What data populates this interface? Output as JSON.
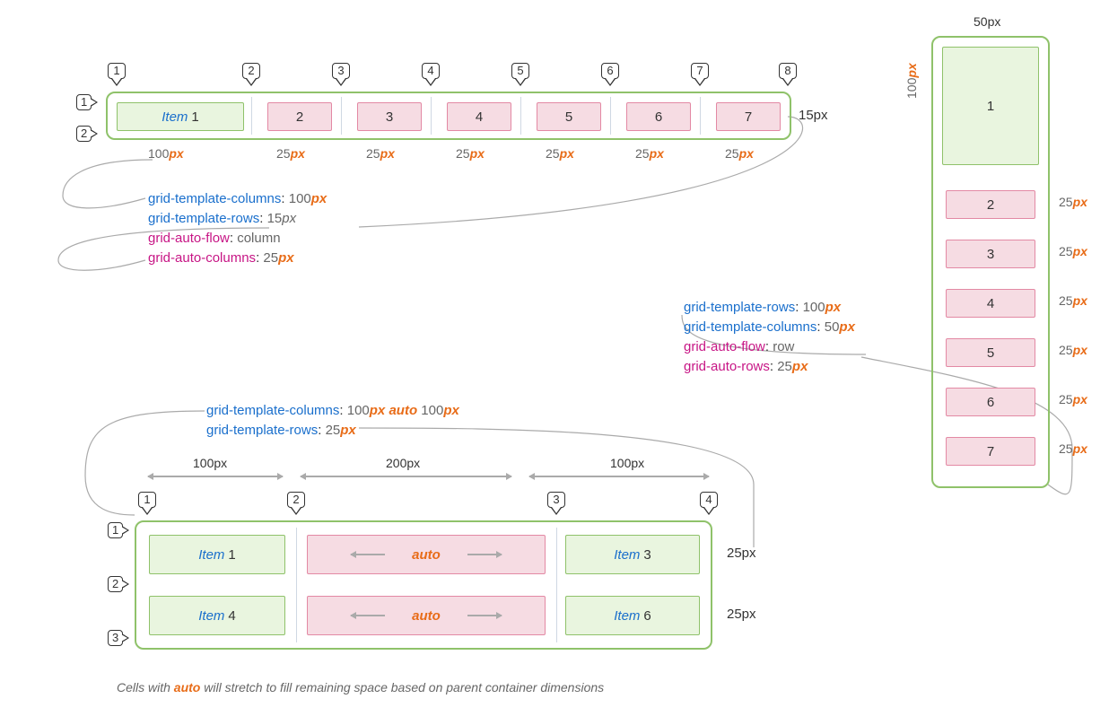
{
  "diagram1": {
    "items": [
      "1",
      "2",
      "3",
      "4",
      "5",
      "6",
      "7"
    ],
    "itemWord": "Item",
    "colLines": [
      "1",
      "2",
      "3",
      "4",
      "5",
      "6",
      "7",
      "8"
    ],
    "rowLines": [
      "1",
      "2"
    ],
    "rowLabel": "15px",
    "tracks": [
      {
        "v": "100",
        "u": "px"
      },
      {
        "v": "25",
        "u": "px"
      },
      {
        "v": "25",
        "u": "px"
      },
      {
        "v": "25",
        "u": "px"
      },
      {
        "v": "25",
        "u": "px"
      },
      {
        "v": "25",
        "u": "px"
      },
      {
        "v": "25",
        "u": "px"
      }
    ],
    "css": [
      {
        "prop": "grid-template-columns",
        "cls": "blue",
        "val": [
          {
            "t": "100",
            "k": "num"
          },
          {
            "t": "px",
            "k": "px"
          }
        ]
      },
      {
        "prop": "grid-template-rows",
        "cls": "blue",
        "val": [
          {
            "t": "15",
            "k": "num"
          },
          {
            "t": "px",
            "k": "ital"
          }
        ]
      },
      {
        "prop": "grid-auto-flow",
        "cls": "mag",
        "val": [
          {
            "t": "column",
            "k": "txt"
          }
        ]
      },
      {
        "prop": "grid-auto-columns",
        "cls": "mag",
        "val": [
          {
            "t": "25",
            "k": "num"
          },
          {
            "t": "px",
            "k": "px"
          }
        ]
      }
    ]
  },
  "diagram2": {
    "topLabel": "50px",
    "sideLabel": "100px",
    "rowTracks": [
      {
        "v": "25",
        "u": "px"
      },
      {
        "v": "25",
        "u": "px"
      },
      {
        "v": "25",
        "u": "px"
      },
      {
        "v": "25",
        "u": "px"
      },
      {
        "v": "25",
        "u": "px"
      },
      {
        "v": "25",
        "u": "px"
      }
    ],
    "items": [
      "1",
      "2",
      "3",
      "4",
      "5",
      "6",
      "7"
    ],
    "css": [
      {
        "prop": "grid-template-rows",
        "cls": "blue",
        "val": [
          {
            "t": "100",
            "k": "num"
          },
          {
            "t": "px",
            "k": "px"
          }
        ]
      },
      {
        "prop": "grid-template-columns",
        "cls": "blue",
        "val": [
          {
            "t": "50",
            "k": "num"
          },
          {
            "t": "px",
            "k": "px"
          }
        ]
      },
      {
        "prop": "grid-auto-flow",
        "cls": "mag",
        "val": [
          {
            "t": "row",
            "k": "txt"
          }
        ]
      },
      {
        "prop": "grid-auto-rows",
        "cls": "mag",
        "val": [
          {
            "t": "25",
            "k": "num"
          },
          {
            "t": "px",
            "k": "px"
          }
        ]
      }
    ]
  },
  "diagram3": {
    "topCss": [
      {
        "prop": "grid-template-columns",
        "cls": "blue",
        "val": [
          {
            "t": "100",
            "k": "num"
          },
          {
            "t": "px",
            "k": "px"
          },
          {
            "t": " auto ",
            "k": "auto"
          },
          {
            "t": "100",
            "k": "num"
          },
          {
            "t": "px",
            "k": "px"
          }
        ]
      },
      {
        "prop": "grid-template-rows",
        "cls": "blue",
        "val": [
          {
            "t": "25",
            "k": "num"
          },
          {
            "t": "px",
            "k": "px"
          }
        ]
      }
    ],
    "dims": [
      "100px",
      "200px",
      "100px"
    ],
    "colLines": [
      "1",
      "2",
      "3",
      "4"
    ],
    "rowLines": [
      "1",
      "2",
      "3"
    ],
    "rowLabels": [
      "25px",
      "25px"
    ],
    "autoWord": "auto",
    "items": [
      {
        "txt": "1",
        "kind": "green"
      },
      {
        "txt": "auto",
        "kind": "pink-auto"
      },
      {
        "txt": "3",
        "kind": "green"
      },
      {
        "txt": "4",
        "kind": "green"
      },
      {
        "txt": "auto",
        "kind": "pink-auto"
      },
      {
        "txt": "6",
        "kind": "green"
      }
    ],
    "itemWord": "Item"
  },
  "footer": {
    "pre": "Cells with ",
    "auto": "auto",
    "post": " will stretch to fill remaining space based on parent container dimensions"
  }
}
